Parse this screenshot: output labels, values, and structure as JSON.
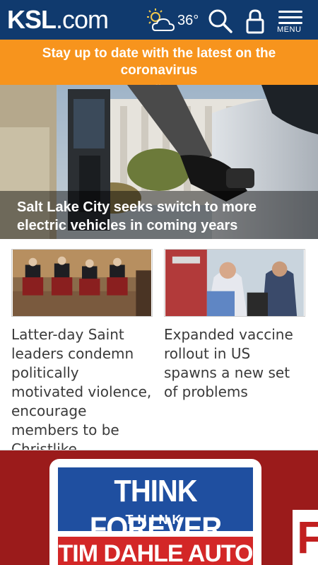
{
  "header": {
    "logo_ksl": "KSL",
    "logo_dotcom": ".com",
    "weather_temp": "36°",
    "menu_label": "MENU",
    "bg_color": "#103a6e"
  },
  "alert": {
    "text": "Stay up to date with the latest on the coronavirus",
    "arrow": "»",
    "bg_color": "#f7941d"
  },
  "hero": {
    "headline": "Salt Lake City seeks switch to more electric vehicles in coming years"
  },
  "stories": [
    {
      "title": "Latter-day Saint leaders condemn politically motivated violence, encourage members to be Christlike"
    },
    {
      "title": "Expanded vaccine rollout in US spawns a new set of problems"
    }
  ],
  "ad": {
    "line1": "THINK FOREVER",
    "line2": "THINK",
    "line3": "TIM DAHLE AUTO",
    "edge_letter": "F"
  },
  "icons": {
    "weather": "partly-cloudy-icon",
    "search": "search-icon",
    "account": "user-icon",
    "menu": "hamburger-menu-icon"
  }
}
